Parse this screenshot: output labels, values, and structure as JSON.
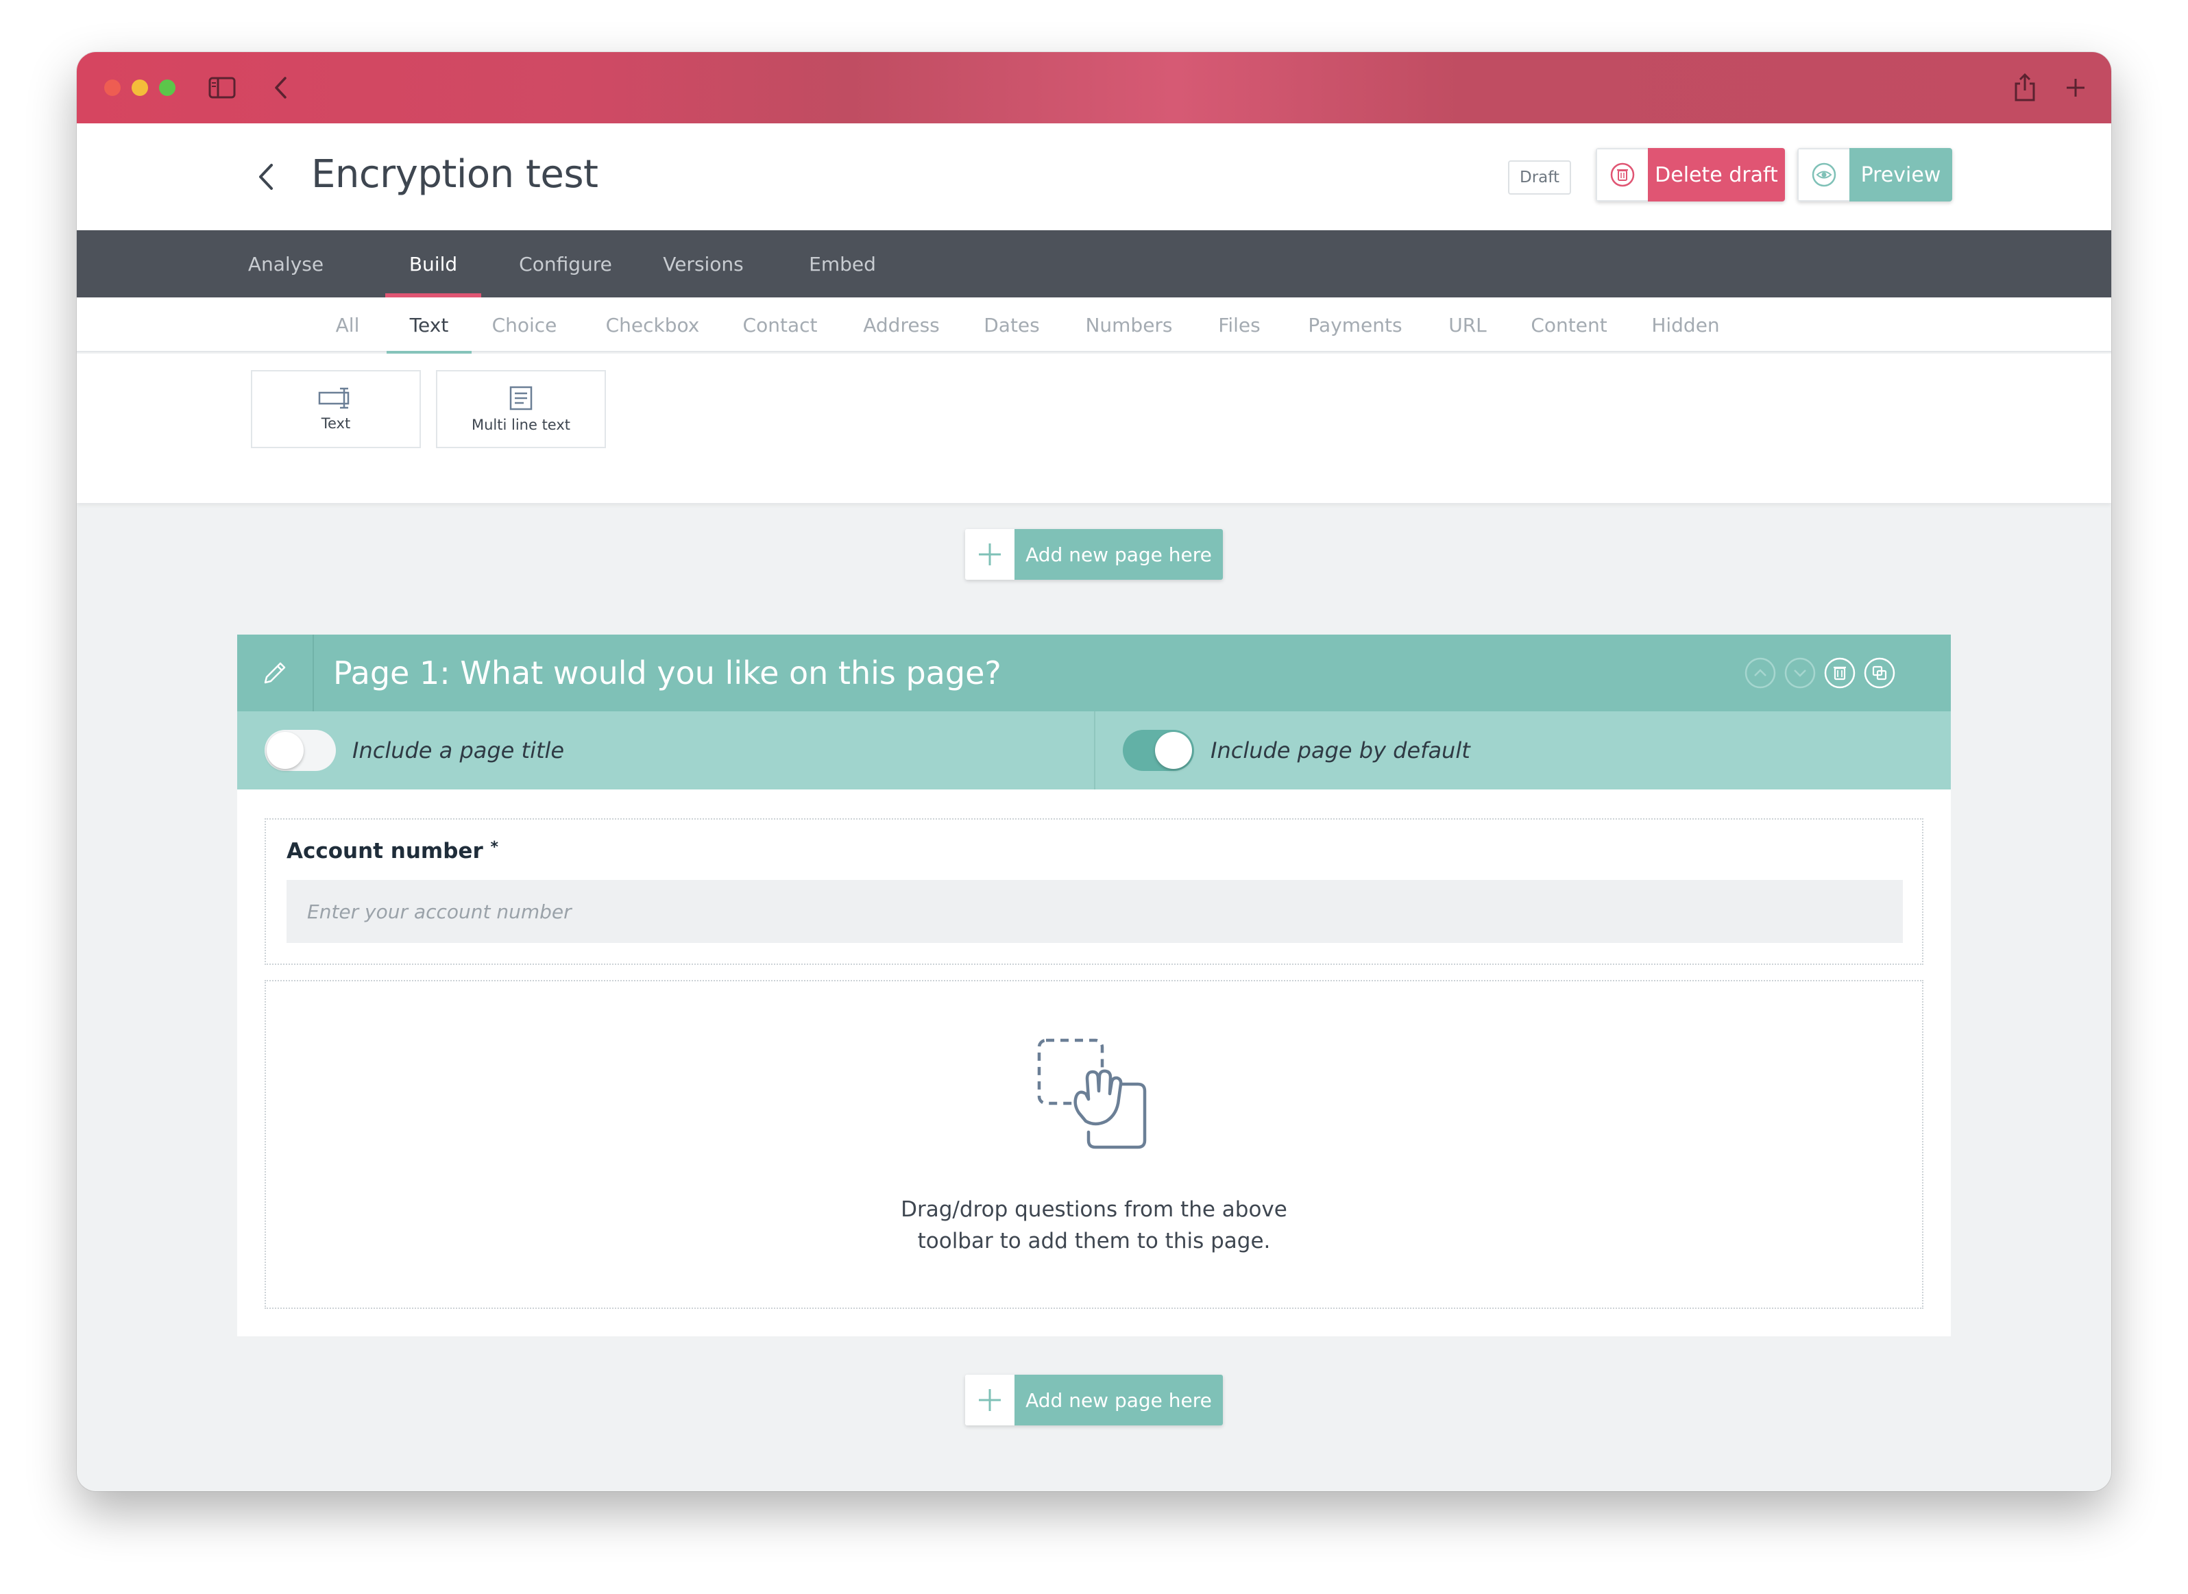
{
  "window": {
    "colors": {
      "brand_red": "#d64560",
      "teal": "#7fc1b7",
      "teal_light": "#a0d4cd",
      "nav_bg": "#4d525a"
    }
  },
  "header": {
    "title": "Encryption test",
    "status_badge": "Draft",
    "delete_label": "Delete draft",
    "preview_label": "Preview"
  },
  "nav": {
    "tabs": [
      {
        "label": "Analyse",
        "active": false
      },
      {
        "label": "Build",
        "active": true
      },
      {
        "label": "Configure",
        "active": false
      },
      {
        "label": "Versions",
        "active": false
      },
      {
        "label": "Embed",
        "active": false
      }
    ]
  },
  "subnav": {
    "items": [
      {
        "label": "All",
        "active": false
      },
      {
        "label": "Text",
        "active": true
      },
      {
        "label": "Choice",
        "active": false
      },
      {
        "label": "Checkbox",
        "active": false
      },
      {
        "label": "Contact",
        "active": false
      },
      {
        "label": "Address",
        "active": false
      },
      {
        "label": "Dates",
        "active": false
      },
      {
        "label": "Numbers",
        "active": false
      },
      {
        "label": "Files",
        "active": false
      },
      {
        "label": "Payments",
        "active": false
      },
      {
        "label": "URL",
        "active": false
      },
      {
        "label": "Content",
        "active": false
      },
      {
        "label": "Hidden",
        "active": false
      }
    ]
  },
  "toolbox": {
    "tools": [
      {
        "label": "Text",
        "icon": "text-field-icon"
      },
      {
        "label": "Multi line text",
        "icon": "multiline-text-icon"
      }
    ]
  },
  "add_page": {
    "label": "Add new page here"
  },
  "page": {
    "title": "Page 1: What would you like on this page?",
    "include_title_label": "Include a page title",
    "include_title_on": false,
    "include_default_label": "Include page by default",
    "include_default_on": true
  },
  "question": {
    "label": "Account number",
    "required_mark": "*",
    "placeholder": "Enter your account number"
  },
  "dropzone": {
    "line1": "Drag/drop questions from the above",
    "line2": "toolbar to add them to this page."
  }
}
